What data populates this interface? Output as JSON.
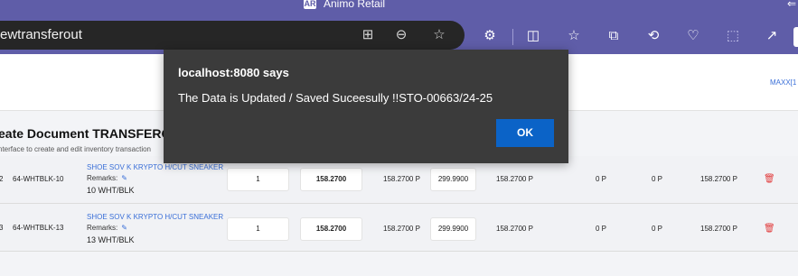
{
  "browser": {
    "window_title": "Animo Retail",
    "app_logo": "AR",
    "url": "ewtransferout",
    "back_icon": "arrow-back-icon",
    "url_icons": [
      "app-available-icon",
      "zoom-out-icon",
      "favorite-star-icon"
    ],
    "toolbar_icons": [
      "extensions-icon",
      "split-screen-icon",
      "favorites-icon",
      "collections-icon",
      "history-icon",
      "browser-essentials-icon",
      "screenshot-icon",
      "share-icon"
    ]
  },
  "page": {
    "header_link": "MAXX[1",
    "doc_title": "eate Document TRANSFEROUT",
    "doc_subtitle": "nterface to create and edit inventory transaction"
  },
  "table": {
    "rows": [
      {
        "idx": "2",
        "code": "64-WHTBLK-10",
        "product": "SHOE SOV K KRYPTO H/CUT SNEAKER",
        "remarks_label": "Remarks:",
        "color": "10 WHT/BLK",
        "qty": "1",
        "rate": "158.2700",
        "amount1": "158.2700 P",
        "mrp": "299.9900",
        "amount2": "158.2700 P",
        "tax1": "0 P",
        "tax2": "0 P",
        "total": "158.2700 P"
      },
      {
        "idx": "3",
        "code": "64-WHTBLK-13",
        "product": "SHOE SOV K KRYPTO H/CUT SNEAKER",
        "remarks_label": "Remarks:",
        "color": "13 WHT/BLK",
        "qty": "1",
        "rate": "158.2700",
        "amount1": "158.2700 P",
        "mrp": "299.9900",
        "amount2": "158.2700 P",
        "tax1": "0 P",
        "tax2": "0 P",
        "total": "158.2700 P"
      }
    ]
  },
  "dialog": {
    "title": "localhost:8080 says",
    "message": "The Data is Updated / Saved Suceesully !!STO-00663/24-25",
    "ok_label": "OK"
  }
}
